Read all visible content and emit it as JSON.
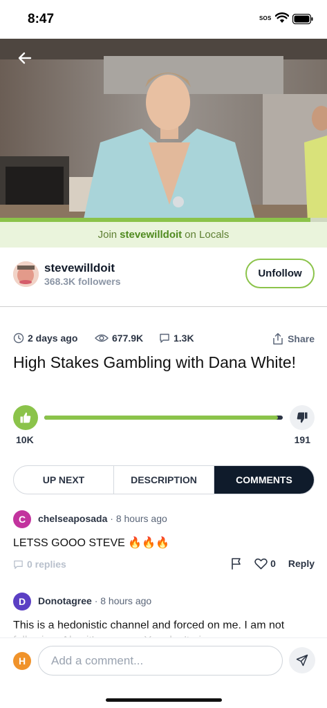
{
  "status_bar": {
    "time": "8:47",
    "sos": "SOS"
  },
  "video": {
    "progress": 0.95
  },
  "locals_banner": {
    "prefix": "Join",
    "channel": "stevewilldoit",
    "suffix": "on Locals"
  },
  "channel": {
    "name": "stevewilldoit",
    "followers": "368.3K followers",
    "unfollow_label": "Unfollow"
  },
  "meta": {
    "posted": "2 days ago",
    "views": "677.9K",
    "comments": "1.3K",
    "share_label": "Share"
  },
  "title": "High Stakes Gambling with Dana White!",
  "rating": {
    "likes": "10K",
    "dislikes": "191",
    "like_ratio": 0.98
  },
  "tabs": [
    {
      "label": "UP NEXT",
      "active": false
    },
    {
      "label": "DESCRIPTION",
      "active": false
    },
    {
      "label": "COMMENTS",
      "active": true
    }
  ],
  "comments": [
    {
      "initial": "C",
      "avatar_color": "#c2339e",
      "author": "chelseaposada",
      "time": "· 8 hours ago",
      "text": "LETSS GOOO STEVE 🔥🔥🔥",
      "replies": "0 replies",
      "likes": "0",
      "reply_label": "Reply"
    },
    {
      "initial": "D",
      "avatar_color": "#5b3fc4",
      "author": "Donotagree",
      "time": "· 8 hours ago",
      "text": "This is a hedonistic channel and forced on me. I am not following. Also it's a scam. You don't give away"
    }
  ],
  "composer": {
    "initial": "H",
    "placeholder": "Add a comment..."
  }
}
